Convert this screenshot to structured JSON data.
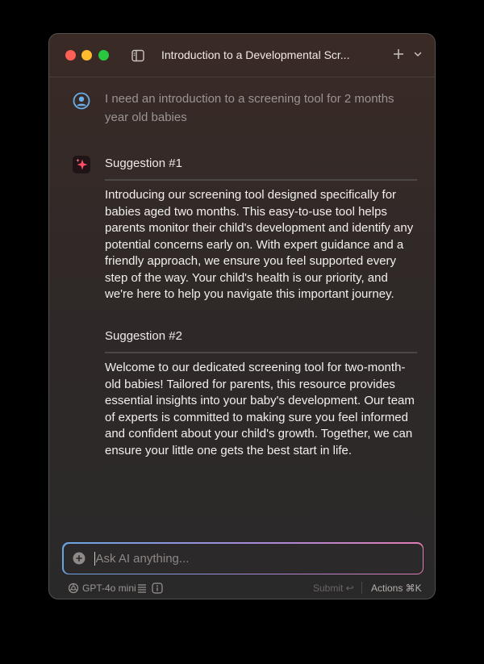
{
  "window": {
    "title": "Introduction to a Developmental Scr...",
    "colors": {
      "close": "#fe5f57",
      "minimize": "#febc2e",
      "zoom": "#28c840"
    }
  },
  "conversation": {
    "user_message": "I need an introduction to a screening tool for 2 months year old babies",
    "suggestions": [
      {
        "heading": "Suggestion #1",
        "text": "Introducing our screening tool designed specifically for babies aged two months. This easy-to-use tool helps parents monitor their child's development and identify any potential concerns early on. With expert guidance and a friendly approach, we ensure you feel supported every step of the way. Your child's health is our priority, and we're here to help you navigate this important journey."
      },
      {
        "heading": "Suggestion #2",
        "text": "Welcome to our dedicated screening tool for two-month-old babies! Tailored for parents, this resource provides essential insights into your baby's development. Our team of experts is committed to making sure you feel informed and confident about your child's growth. Together, we can ensure your little one gets the best start in life."
      }
    ]
  },
  "input": {
    "placeholder": "Ask AI anything...",
    "value": ""
  },
  "footer": {
    "model": "GPT-4o mini",
    "submit": "Submit ↩",
    "actions": "Actions ⌘K"
  },
  "icons": {
    "sidebar": "sidebar-toggle-icon",
    "new_chat": "plus-icon",
    "menu": "chevron-down-icon",
    "user": "user-avatar-icon",
    "ai": "sparkle-icon",
    "add": "plus-circle-icon",
    "model": "openai-logo-icon",
    "list": "list-icon",
    "info": "info-icon"
  }
}
